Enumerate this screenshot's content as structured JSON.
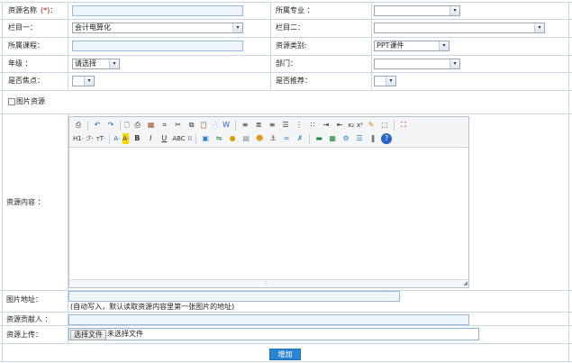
{
  "form": {
    "name_label": "资源名称",
    "required_mark": "(*)",
    "colon": "：",
    "major_label": "所属专业 ：",
    "col1_label": "栏目一：",
    "col1_value": "会计电算化",
    "col2_label": "栏目二：",
    "course_label": "所属课程：",
    "type_label": "资源类别:",
    "type_value": "PPT课件",
    "grade_label": "年级 ：",
    "grade_value": "请选择",
    "dept_label": "部门：",
    "focus_label": "是否焦点：",
    "recommend_label": "是否推荐：",
    "image_resource_label": "图片资源",
    "content_label": "资源内容 ：",
    "image_address_label": "图片地址：",
    "image_address_hint": "(自动写入，默认读取资源内容里第一张图片的地址)",
    "contributor_label": "资源贡献人 ：",
    "upload_label": "资源上传：",
    "file_button": "选择文件",
    "file_status": "未选择文件",
    "submit_label": "增加"
  },
  "icons": {
    "arrow": "▾",
    "grip": "⁘",
    "resize": "◢"
  },
  "toolbar": {
    "row1": [
      {
        "name": "source-icon",
        "glyph": "⎙"
      },
      {
        "sep": true
      },
      {
        "name": "undo-icon",
        "glyph": "↶",
        "color": "#1f5fbf"
      },
      {
        "name": "redo-icon",
        "glyph": "↷",
        "color": "#1f5fbf"
      },
      {
        "sep": true
      },
      {
        "name": "preview-icon",
        "glyph": "🗋"
      },
      {
        "name": "print-icon",
        "glyph": "⎙"
      },
      {
        "name": "template-icon",
        "glyph": "▦",
        "color": "#a0522d"
      },
      {
        "name": "code-icon",
        "glyph": "⌗"
      },
      {
        "name": "cut-icon",
        "glyph": "✂"
      },
      {
        "name": "copy-icon",
        "glyph": "⧉"
      },
      {
        "name": "paste-icon",
        "glyph": "📋"
      },
      {
        "name": "paste-text-icon",
        "glyph": "📄"
      },
      {
        "name": "paste-word-icon",
        "glyph": "W",
        "color": "#1f5fbf"
      },
      {
        "sep": true
      },
      {
        "name": "align-left-icon",
        "glyph": "≡"
      },
      {
        "name": "align-center-icon",
        "glyph": "≣"
      },
      {
        "name": "align-right-icon",
        "glyph": "≡"
      },
      {
        "name": "align-justify-icon",
        "glyph": "☰"
      },
      {
        "name": "ordered-list-icon",
        "glyph": "⋮"
      },
      {
        "name": "unordered-list-icon",
        "glyph": "∷"
      },
      {
        "name": "indent-icon",
        "glyph": "⇥"
      },
      {
        "name": "outdent-icon",
        "glyph": "⇤"
      },
      {
        "name": "subscript-icon",
        "glyph": "x₂"
      },
      {
        "name": "superscript-icon",
        "glyph": "x²"
      },
      {
        "name": "clear-format-icon",
        "glyph": "✎",
        "color": "#c28a00"
      },
      {
        "name": "select-all-icon",
        "glyph": "⬚"
      },
      {
        "sep": true
      },
      {
        "name": "fullscreen-icon",
        "glyph": "⛶",
        "color": "#c00"
      }
    ],
    "row2": [
      {
        "name": "heading-icon",
        "glyph": "H1·"
      },
      {
        "name": "font-family-icon",
        "glyph": "ℱ·"
      },
      {
        "name": "font-size-icon",
        "glyph": "тT·"
      },
      {
        "sep": true
      },
      {
        "name": "font-color-icon",
        "glyph": "A·",
        "color": "#1f5fbf"
      },
      {
        "name": "highlight-icon",
        "glyph": "A·",
        "color": "#222",
        "bg": "#ffd800"
      },
      {
        "name": "bold-icon",
        "glyph": "B",
        "bold": true
      },
      {
        "name": "italic-icon",
        "glyph": "I",
        "italic": true
      },
      {
        "name": "underline-icon",
        "glyph": "U",
        "underline": true
      },
      {
        "name": "strikethrough-icon",
        "glyph": "ABC"
      },
      {
        "name": "line-height-icon",
        "glyph": "⁞⁞"
      },
      {
        "sep": true
      },
      {
        "name": "image-icon",
        "glyph": "▣",
        "color": "#2f7fc9"
      },
      {
        "name": "flash-icon",
        "glyph": "⇋",
        "color": "#1a8a3a"
      },
      {
        "name": "media-icon",
        "glyph": "●",
        "color": "#d6a200"
      },
      {
        "name": "table-icon",
        "glyph": "▤",
        "color": "#888"
      },
      {
        "name": "emoticon-icon",
        "glyph": "☻",
        "color": "#e08a00"
      },
      {
        "name": "anchor-icon",
        "glyph": "⚓",
        "color": "#555"
      },
      {
        "name": "link-icon",
        "glyph": "∞",
        "color": "#2f7fc9"
      },
      {
        "name": "unlink-icon",
        "glyph": "✗",
        "color": "#2f7fc9"
      },
      {
        "sep": true
      },
      {
        "name": "hr-icon",
        "glyph": "▬",
        "color": "#1a8a3a"
      },
      {
        "name": "map-icon",
        "glyph": "▦",
        "color": "#1a8a3a"
      },
      {
        "name": "insert-file-icon",
        "glyph": "⚙",
        "color": "#2f7fc9"
      },
      {
        "name": "page-break-icon",
        "glyph": "☰",
        "color": "#2f7fc9"
      },
      {
        "name": "attachment-icon",
        "glyph": "❚",
        "color": "#777"
      },
      {
        "name": "about-icon",
        "glyph": "?",
        "color": "#fff",
        "bg": "#2a64c8",
        "round": true
      }
    ]
  }
}
